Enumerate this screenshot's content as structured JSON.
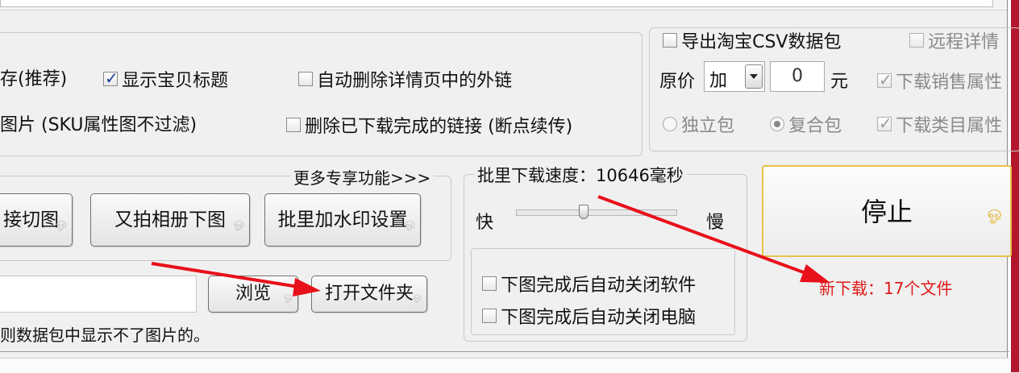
{
  "options": {
    "save_recommended": "存(推荐)",
    "show_title": "显示宝贝标题",
    "remove_links": "自动删除详情页中的外链",
    "images_sku": "图片 (SKU属性图不过滤)",
    "delete_downloaded": "删除已下载完成的链接 (断点续传)"
  },
  "taobao": {
    "export_csv": "导出淘宝CSV数据包",
    "remote_detail": "远程详情",
    "price_label": "原价",
    "price_op": "加",
    "price_value": "0",
    "price_unit": "元",
    "download_sale_attr": "下载销售属性",
    "download_cat_attr": "下载类目属性",
    "single_pack": "独立包",
    "combo_pack": "复合包"
  },
  "features": {
    "more_link": "更多专享功能>>>",
    "cut_image_btn": "接切图",
    "youpai_btn": "又拍相册下图",
    "watermark_btn": "批里加水印设置"
  },
  "folder": {
    "browse_btn": "浏览",
    "open_folder_btn": "打开文件夹",
    "note": "则数据包中显示不了图片的。"
  },
  "speed": {
    "title": "批里下载速度：10646毫秒",
    "fast": "快",
    "slow": "慢",
    "slider_fraction": 0.42,
    "auto_close_software": "下图完成后自动关闭软件",
    "auto_close_pc": "下图完成后自动关闭电脑"
  },
  "download": {
    "stop_btn": "停止",
    "status": "新下载：17个文件"
  },
  "colors": {
    "arrow": "#e8101a",
    "status_text": "#e01818",
    "stop_border": "#e8c24a",
    "frame_red": "#b2172e"
  }
}
